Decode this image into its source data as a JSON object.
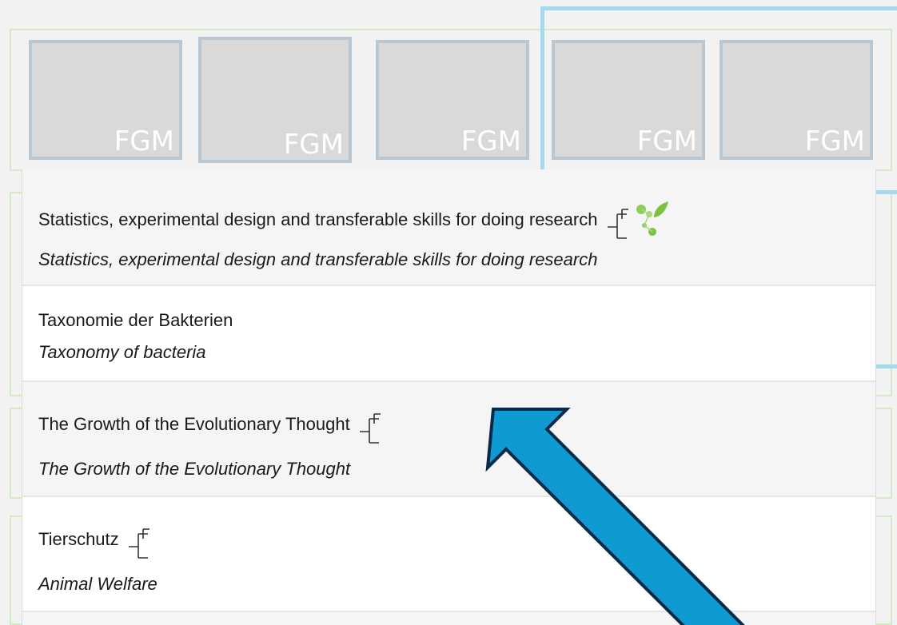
{
  "tiles": [
    {
      "label": "FGM"
    },
    {
      "label": "FGM"
    },
    {
      "label": "FGM"
    },
    {
      "label": "FGM"
    },
    {
      "label": "FGM"
    }
  ],
  "courses": [
    {
      "title": "Statistics, experimental design and transferable skills for doing research",
      "subtitle": "Statistics, experimental design and transferable skills for doing research"
    },
    {
      "title": "Taxonomie der Bakterien",
      "subtitle": "Taxonomy of bacteria"
    },
    {
      "title": "The Growth of the Evolutionary Thought",
      "subtitle": "The Growth of the Evolutionary Thought"
    },
    {
      "title": "Tierschutz",
      "subtitle": "Animal Welfare"
    }
  ],
  "colors": {
    "arrow_fill": "#0f9bd1",
    "arrow_stroke": "#0a2a4a",
    "leaf_green": "#7cc242",
    "tile_fill": "#d9d9d9",
    "tile_border": "#b9c7d3"
  },
  "icons": {
    "tree": "tree-diagram-icon",
    "leaf": "leaf-molecule-icon",
    "arrow": "pointer-arrow"
  }
}
